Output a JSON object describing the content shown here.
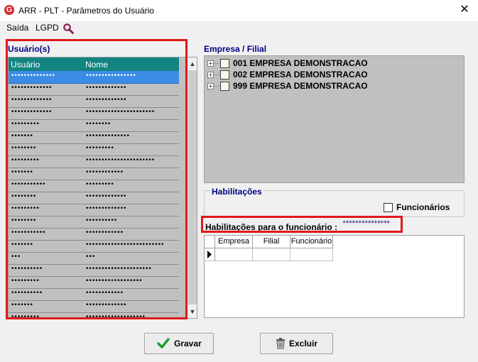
{
  "window": {
    "title": "ARR - PLT - Parâmetros do Usuário",
    "close_glyph": "✕",
    "app_icon_letter": "G"
  },
  "menu": {
    "items": [
      "Saída",
      "LGPD"
    ]
  },
  "users": {
    "title": "Usuário(s)",
    "columns": [
      "Usuário",
      "Nome"
    ],
    "rows": [
      [
        "••••••••••••••",
        "••••••••••••••••"
      ],
      [
        "•••••••••••••",
        "•••••••••••••"
      ],
      [
        "•••••••••••••",
        "•••••••••••••"
      ],
      [
        "•••••••••••••",
        "••••••••••••••••••••••"
      ],
      [
        "•••••••••",
        "••••••••"
      ],
      [
        "•••••••",
        "••••••••••••••"
      ],
      [
        "••••••••",
        "•••••••••"
      ],
      [
        "•••••••••",
        "••••••••••••••••••••••"
      ],
      [
        "•••••••",
        "••••••••••••"
      ],
      [
        "•••••••••••",
        "•••••••••"
      ],
      [
        "••••••••",
        "•••••••••••••"
      ],
      [
        "•••••••••",
        "•••••••••••••"
      ],
      [
        "••••••••",
        "••••••••••"
      ],
      [
        "•••••••••••",
        "••••••••••••"
      ],
      [
        "•••••••",
        "•••••••••••••••••••••••••"
      ],
      [
        "•••",
        "•••"
      ],
      [
        "••••••••••",
        "•••••••••••••••••••••"
      ],
      [
        "•••••••••",
        "••••••••••••••••••"
      ],
      [
        "••••••••••",
        "••••••••••••"
      ],
      [
        "•••••••",
        "•••••••••••••"
      ],
      [
        "•••••••••",
        "•••••••••••••••••••"
      ]
    ],
    "selected_index": 0
  },
  "tree": {
    "title": "Empresa / Filial",
    "items": [
      "001 EMPRESA DEMONSTRACAO",
      "002 EMPRESA DEMONSTRACAO",
      "999 EMPRESA DEMONSTRACAO"
    ],
    "expander_glyph": "+"
  },
  "habilitacoes": {
    "title": "Habilitações",
    "checkbox_label": "Funcionários",
    "funcionario_label": "Habilitações para o funcionário :",
    "funcionario_value": "***************",
    "columns": [
      "Empresa",
      "Filial",
      "Funcionário"
    ]
  },
  "buttons": {
    "save": "Gravar",
    "delete": "Excluir"
  },
  "colors": {
    "grid_header": "#128482",
    "selection": "#3c8ce6",
    "highlight": "#e01818",
    "title_blue": "#000080"
  }
}
